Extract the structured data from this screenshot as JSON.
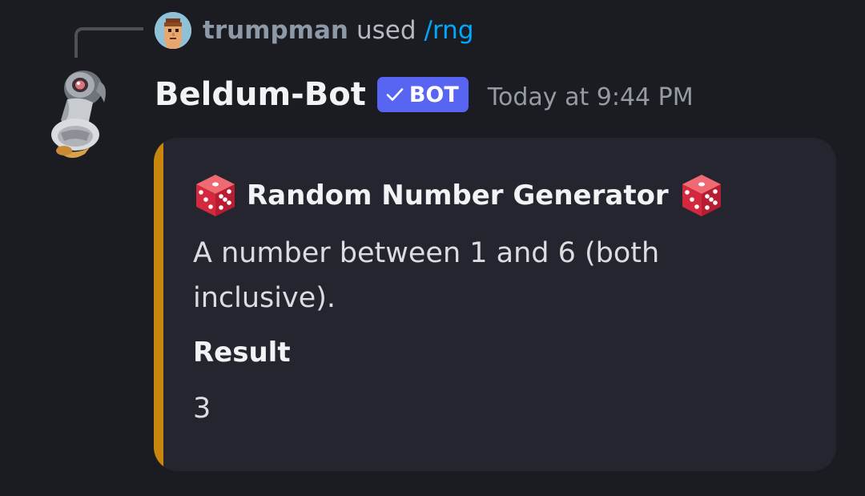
{
  "reply": {
    "username": "trumpman",
    "used_text": "used",
    "command": "/rng"
  },
  "message": {
    "author": "Beldum-Bot",
    "bot_tag": "BOT",
    "timestamp": "Today at 9:44 PM"
  },
  "embed": {
    "title": "Random Number Generator",
    "title_icon": "game-die-icon",
    "description": "A number between 1 and 6 (both inclusive).",
    "field_name": "Result",
    "field_value": "3",
    "accent_color": "#c9860f"
  },
  "colors": {
    "background": "#1b1b22",
    "embed_background": "#25252f",
    "bot_tag": "#5865f2",
    "command_link": "#00a8fc"
  }
}
